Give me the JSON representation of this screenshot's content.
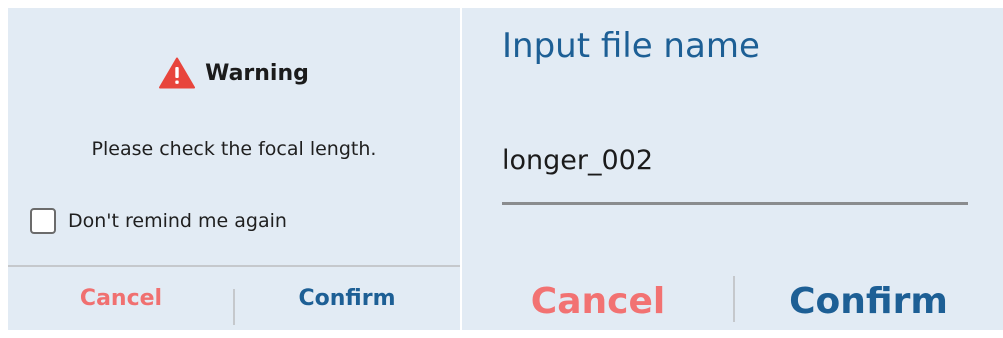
{
  "warning_dialog": {
    "title": "Warning",
    "message": "Please check the focal length.",
    "remind_checkbox": {
      "label": "Don't remind me again",
      "checked": false
    },
    "cancel_label": "Cancel",
    "confirm_label": "Confirm",
    "icon": "warning-triangle-icon"
  },
  "input_dialog": {
    "title": "Input file name",
    "file_name_value": "longer_002",
    "cancel_label": "Cancel",
    "confirm_label": "Confirm"
  },
  "colors": {
    "dialog_background": "#e2ebf4",
    "accent_blue": "#1d5f95",
    "cancel_red": "#f07070",
    "warning_red": "#e8453c",
    "divider": "#c5c8cc"
  }
}
